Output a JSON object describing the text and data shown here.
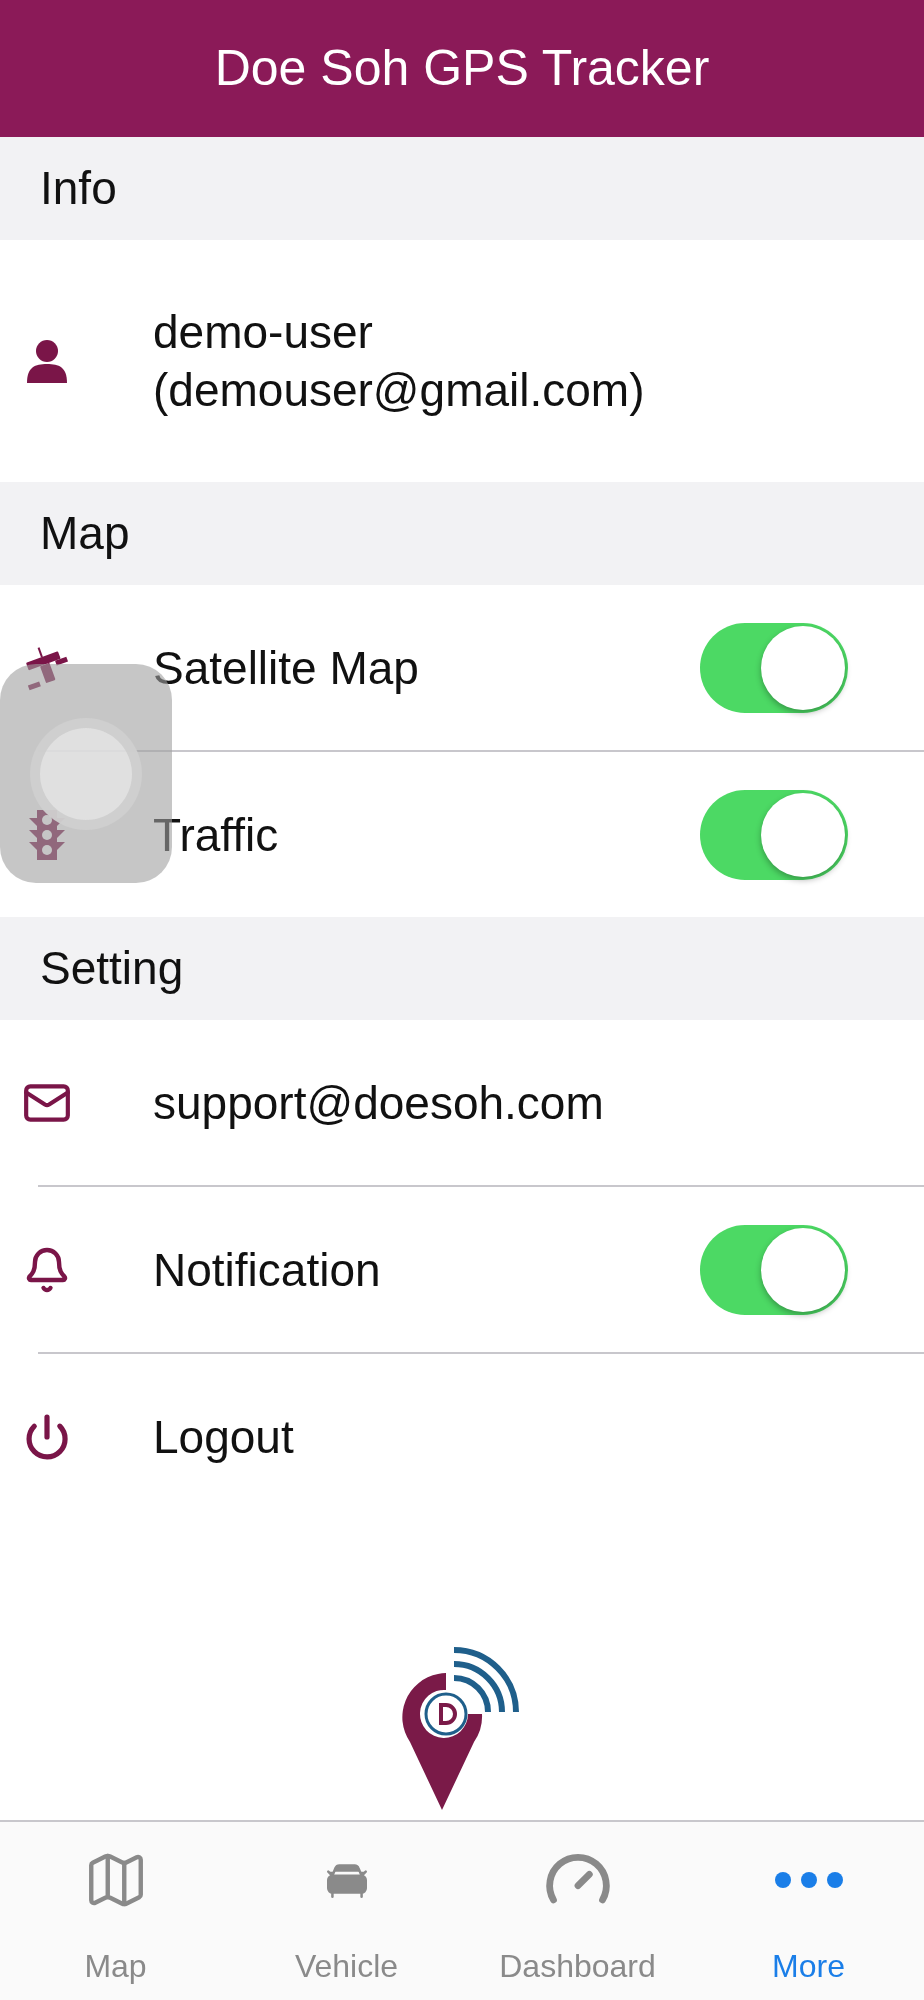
{
  "header": {
    "title": "Doe Soh GPS Tracker"
  },
  "sections": [
    {
      "title": "Info",
      "rows": [
        {
          "kind": "plain",
          "lines": [
            "demo-user",
            "(demouser@gmail.com)"
          ]
        }
      ]
    },
    {
      "title": "Map",
      "rows": [
        {
          "kind": "toggle",
          "lines": [
            "Satellite Map"
          ],
          "on": true
        },
        {
          "kind": "toggle",
          "lines": [
            "Traffic"
          ],
          "on": true
        }
      ]
    },
    {
      "title": "Setting",
      "rows": [
        {
          "kind": "plain",
          "lines": [
            "support@doesoh.com"
          ]
        },
        {
          "kind": "toggle",
          "lines": [
            "Notification"
          ],
          "on": true
        },
        {
          "kind": "plain",
          "lines": [
            "Logout"
          ]
        }
      ]
    }
  ],
  "tabs": [
    {
      "label": "Map",
      "selected": false
    },
    {
      "label": "Vehicle",
      "selected": false
    },
    {
      "label": "Dashboard",
      "selected": false
    },
    {
      "label": "More",
      "selected": true
    }
  ]
}
